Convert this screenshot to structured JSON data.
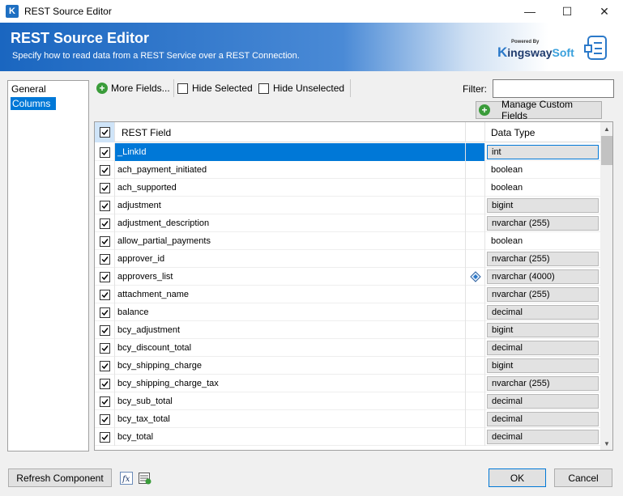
{
  "window": {
    "title": "REST Source Editor",
    "minimize": "—",
    "maximize": "☐",
    "close": "✕"
  },
  "banner": {
    "title": "REST Source Editor",
    "subtitle": "Specify how to read data from a REST Service over a REST Connection.",
    "logo_small": "Powered By",
    "logo_k": "K",
    "logo_ingsway": "ingsway",
    "logo_soft": "Soft"
  },
  "nav": {
    "items": [
      {
        "label": "General"
      },
      {
        "label": "Columns"
      }
    ]
  },
  "toolbar": {
    "more_fields": "More Fields...",
    "hide_selected": "Hide Selected",
    "hide_unselected": "Hide Unselected",
    "filter_label": "Filter:",
    "filter_value": "",
    "manage_custom_fields": "Manage Custom Fields"
  },
  "grid": {
    "headers": {
      "name": "REST Field",
      "type": "Data Type"
    },
    "rows": [
      {
        "name": "_LinkId",
        "type": "int",
        "boxed": true,
        "selected": true,
        "icon": false
      },
      {
        "name": "ach_payment_initiated",
        "type": "boolean",
        "boxed": false,
        "selected": false,
        "icon": false
      },
      {
        "name": "ach_supported",
        "type": "boolean",
        "boxed": false,
        "selected": false,
        "icon": false
      },
      {
        "name": "adjustment",
        "type": "bigint",
        "boxed": true,
        "selected": false,
        "icon": false
      },
      {
        "name": "adjustment_description",
        "type": "nvarchar (255)",
        "boxed": true,
        "selected": false,
        "icon": false
      },
      {
        "name": "allow_partial_payments",
        "type": "boolean",
        "boxed": false,
        "selected": false,
        "icon": false
      },
      {
        "name": "approver_id",
        "type": "nvarchar (255)",
        "boxed": true,
        "selected": false,
        "icon": false
      },
      {
        "name": "approvers_list",
        "type": "nvarchar (4000)",
        "boxed": true,
        "selected": false,
        "icon": true
      },
      {
        "name": "attachment_name",
        "type": "nvarchar (255)",
        "boxed": true,
        "selected": false,
        "icon": false
      },
      {
        "name": "balance",
        "type": "decimal",
        "boxed": true,
        "selected": false,
        "icon": false
      },
      {
        "name": "bcy_adjustment",
        "type": "bigint",
        "boxed": true,
        "selected": false,
        "icon": false
      },
      {
        "name": "bcy_discount_total",
        "type": "decimal",
        "boxed": true,
        "selected": false,
        "icon": false
      },
      {
        "name": "bcy_shipping_charge",
        "type": "bigint",
        "boxed": true,
        "selected": false,
        "icon": false
      },
      {
        "name": "bcy_shipping_charge_tax",
        "type": "nvarchar (255)",
        "boxed": true,
        "selected": false,
        "icon": false
      },
      {
        "name": "bcy_sub_total",
        "type": "decimal",
        "boxed": true,
        "selected": false,
        "icon": false
      },
      {
        "name": "bcy_tax_total",
        "type": "decimal",
        "boxed": true,
        "selected": false,
        "icon": false
      },
      {
        "name": "bcy_total",
        "type": "decimal",
        "boxed": true,
        "selected": false,
        "icon": false
      }
    ]
  },
  "footer": {
    "refresh": "Refresh Component",
    "fx_icon": "fx",
    "ok": "OK",
    "cancel": "Cancel"
  },
  "colors": {
    "accent": "#0078d7",
    "banner_blue": "#1a66c0",
    "plus_green": "#3a9c3a"
  }
}
